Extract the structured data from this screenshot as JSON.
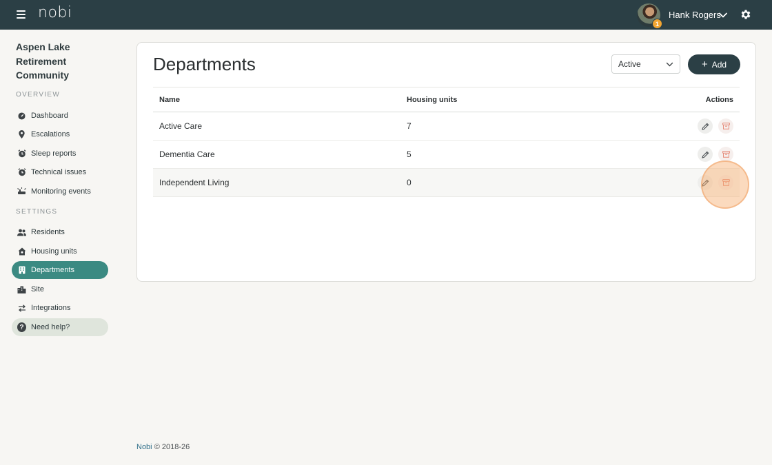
{
  "header": {
    "logo": "nobi",
    "user_name": "Hank Rogers",
    "notification_count": "1"
  },
  "sidebar": {
    "org_name": "Aspen Lake Retirement Community",
    "overview_title": "OVERVIEW",
    "overview_items": [
      {
        "label": "Dashboard",
        "icon": "gauge-icon"
      },
      {
        "label": "Escalations",
        "icon": "map-pin-icon"
      },
      {
        "label": "Sleep reports",
        "icon": "alarm-clock-icon"
      },
      {
        "label": "Technical issues",
        "icon": "alarm-clock-icon"
      },
      {
        "label": "Monitoring events",
        "icon": "monitoring-icon"
      }
    ],
    "settings_title": "SETTINGS",
    "settings_items": [
      {
        "label": "Residents",
        "icon": "people-icon"
      },
      {
        "label": "Housing units",
        "icon": "house-icon"
      },
      {
        "label": "Departments",
        "icon": "building-icon",
        "active": true
      },
      {
        "label": "Site",
        "icon": "city-icon"
      },
      {
        "label": "Integrations",
        "icon": "swap-arrows-icon"
      }
    ],
    "help_label": "Need help?"
  },
  "main": {
    "title": "Departments",
    "filter_value": "Active",
    "add_label": "Add",
    "columns": [
      "Name",
      "Housing units",
      "Actions"
    ],
    "rows": [
      {
        "name": "Active Care",
        "units": "7"
      },
      {
        "name": "Dementia Care",
        "units": "5"
      },
      {
        "name": "Independent Living",
        "units": "0"
      }
    ]
  },
  "footer": {
    "brand": "Nobi",
    "copyright": "© 2018-26"
  },
  "colors": {
    "topbar": "#2b3f45",
    "accent": "#3b8a82",
    "archive": "#e58b7a"
  }
}
